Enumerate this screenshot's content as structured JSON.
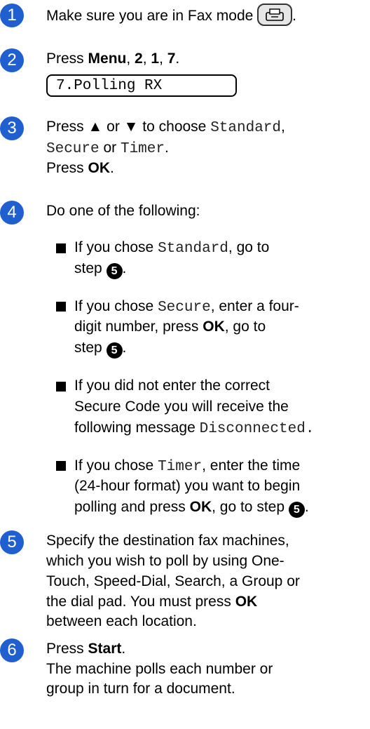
{
  "steps": [
    {
      "num": "1",
      "text_before": "Make sure you are in Fax mode",
      "icon": "fax-mode-icon",
      "text_after": "."
    },
    {
      "num": "2",
      "press": "Press ",
      "k1": "Menu",
      "sep1": ", ",
      "k2": "2",
      "sep2": ", ",
      "k3": "1",
      "sep3": ", ",
      "k4": "7",
      "end": ".",
      "lcd": "7.Polling RX"
    },
    {
      "num": "3",
      "l1a": "Press ",
      "l1b": "▲",
      "l1c": " or ",
      "l1d": "▼",
      "l1e": " to choose ",
      "opt1": "Standard",
      "comma": ",",
      "opt2": "Secure",
      "or": " or ",
      "opt3": "Timer",
      "dot": ".",
      "l3a": "Press ",
      "l3b": "OK",
      "l3c": "."
    },
    {
      "num": "4",
      "intro": "Do one of the following:",
      "b1a": "If you chose ",
      "b1b": "Standard",
      "b1c": ", go to",
      "b1d": "step ",
      "b1ref": "5",
      "b1e": ".",
      "b2a": "If you chose ",
      "b2b": "Secure",
      "b2c": ", enter a four-",
      "b2d": "digit number, press ",
      "b2e": "OK",
      "b2f": ", go to",
      "b2g": "step ",
      "b2ref": "5",
      "b2h": ".",
      "b3a": "If you did not enter the correct",
      "b3b": "Secure Code you will receive the",
      "b3c": "following message ",
      "b3d": "Disconnected.",
      "b4a": "If you chose ",
      "b4b": "Timer",
      "b4c": ", enter the time",
      "b4d": "(24-hour format) you want to begin",
      "b4e": "polling and press ",
      "b4f": "OK",
      "b4g": ", go to step ",
      "b4ref": "5",
      "b4h": "."
    },
    {
      "num": "5",
      "l1": "Specify the destination fax machines,",
      "l2": "which you wish to poll by using One-",
      "l3": "Touch, Speed-Dial, Search, a Group or",
      "l4a": "the dial pad. You must press ",
      "l4b": "OK",
      "l5": "between each location."
    },
    {
      "num": "6",
      "l1a": "Press ",
      "l1b": "Start",
      "l1c": ".",
      "l2": "The machine polls each number or",
      "l3": "group in turn for a document."
    }
  ],
  "colors": {
    "step_circle": "#1f5fcf"
  }
}
